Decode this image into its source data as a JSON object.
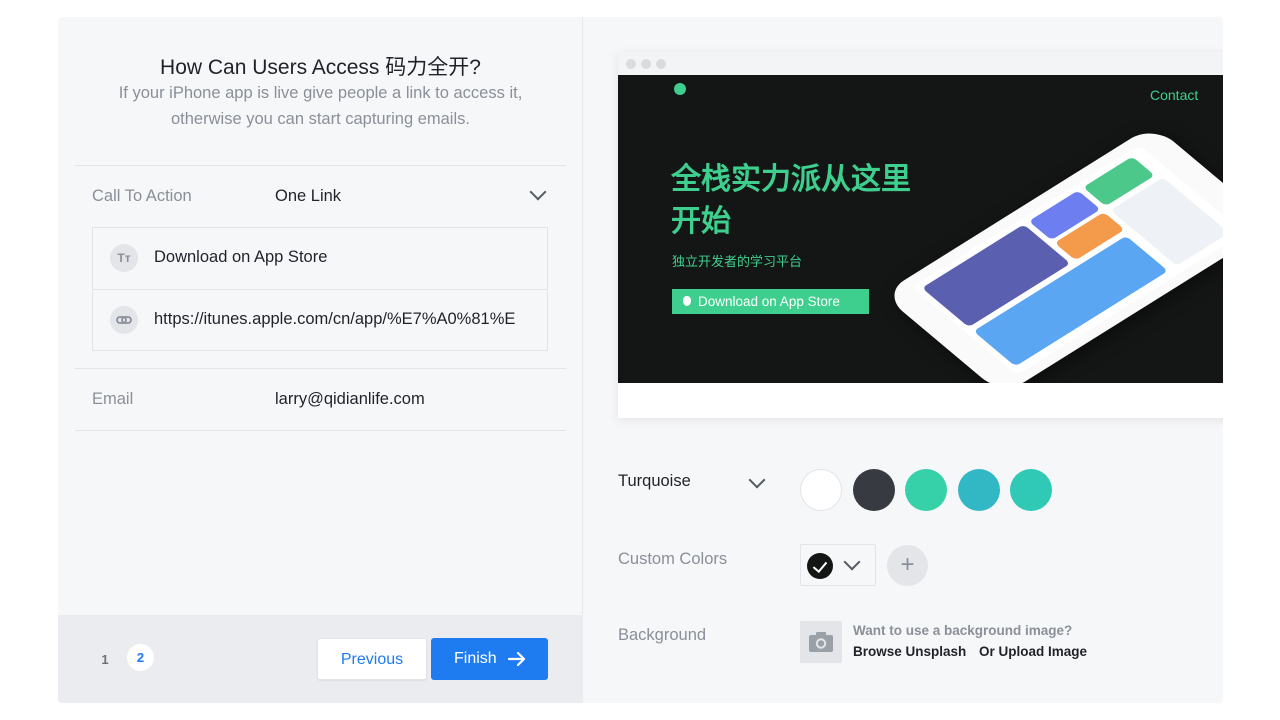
{
  "left": {
    "title": "How Can Users Access 码力全开?",
    "subtitle": "If your iPhone app is live give people a link to access it, otherwise you can start capturing emails.",
    "call_to_action": {
      "label": "Call To Action",
      "value": "One Link"
    },
    "cta_items": [
      {
        "icon": "text-format-icon",
        "icon_glyph": "Tт",
        "text": "Download on App Store"
      },
      {
        "icon": "link-icon",
        "text": "https://itunes.apple.com/cn/app/%E7%A0%81%E"
      }
    ],
    "email": {
      "label": "Email",
      "value": "larry@qidianlife.com"
    },
    "pagination": {
      "pages": [
        "1",
        "2"
      ],
      "current": "2"
    },
    "buttons": {
      "previous": "Previous",
      "finish": "Finish"
    }
  },
  "preview": {
    "contact": "Contact",
    "hero_title": "全栈实力派从这里开始",
    "hero_subtitle": "独立开发者的学习平台",
    "hero_button": "Download on App Store",
    "accent": "#3ecf8e",
    "background": "#141515"
  },
  "theme": {
    "selected": "Turquoise",
    "swatches": [
      "#ffffff",
      "#383a42",
      "#36d1a8",
      "#32b8c4",
      "#2fc9b5"
    ]
  },
  "custom_colors": {
    "label": "Custom Colors",
    "add": "+"
  },
  "background": {
    "label": "Background",
    "prompt": "Want to use a background image?",
    "browse": "Browse Unsplash",
    "upload": "Or Upload Image"
  }
}
